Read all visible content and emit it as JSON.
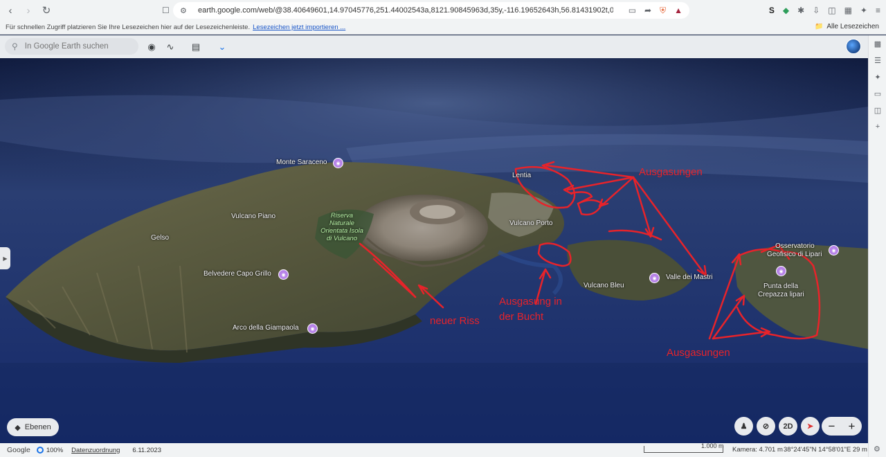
{
  "browser": {
    "url": "earth.google.com/web/@38.40649601,14.97045776,251.44002543a,8121.90845963d,35y,-116.19652643h,56.81431902t,0r/data=CgRCAg...",
    "bookmarks_hint": "Für schnellen Zugriff platzieren Sie Ihre Lesezeichen hier auf der Lesezeichenleiste.",
    "bookmarks_link": "Lesezeichen jetzt importieren ...",
    "all_bookmarks": "Alle Lesezeichen",
    "ext_s": "S"
  },
  "earth": {
    "search_placeholder": "In Google Earth suchen",
    "layers": "Ebenen",
    "view_2d": "2D"
  },
  "places": {
    "monte_saraceno": "Monte Saraceno",
    "lentia": "Lentia",
    "vulcano_piano": "Vulcano Piano",
    "gelso": "Gelso",
    "vulcano_porto": "Vulcano Porto",
    "belvedere": "Belvedere Capo Grillo",
    "vulcano_bleu": "Vulcano Bleu",
    "valle_mastri": "Valle dei Mastri",
    "osservatorio_1": "Osservatorio",
    "osservatorio_2": "Geofisico di Lipari",
    "punta_1": "Punta della",
    "punta_2": "Crepazza lipari",
    "arco": "Arco della Giampaola",
    "reserve_1": "Riserva",
    "reserve_2": "Naturale",
    "reserve_3": "Orientata Isola",
    "reserve_4": "di Vulcano"
  },
  "annotations": {
    "ausgasungen_top": "Ausgasungen",
    "neuer_riss": "neuer Riss",
    "bucht_1": "Ausgasung in",
    "bucht_2": "der Bucht",
    "ausgasungen_bottom": "Ausgasungen"
  },
  "status": {
    "google": "Google",
    "zoom": "100%",
    "attribution": "Datenzuordnung",
    "date": "6.11.2023",
    "scale": "1.000 m",
    "camera": "Kamera: 4.701 m",
    "coords": "38°24'45\"N 14°58'01\"E  29 m"
  },
  "colors": {
    "annotation": "#e8232a",
    "poi": "#b783e8",
    "reserve": "#b9f3a7"
  }
}
